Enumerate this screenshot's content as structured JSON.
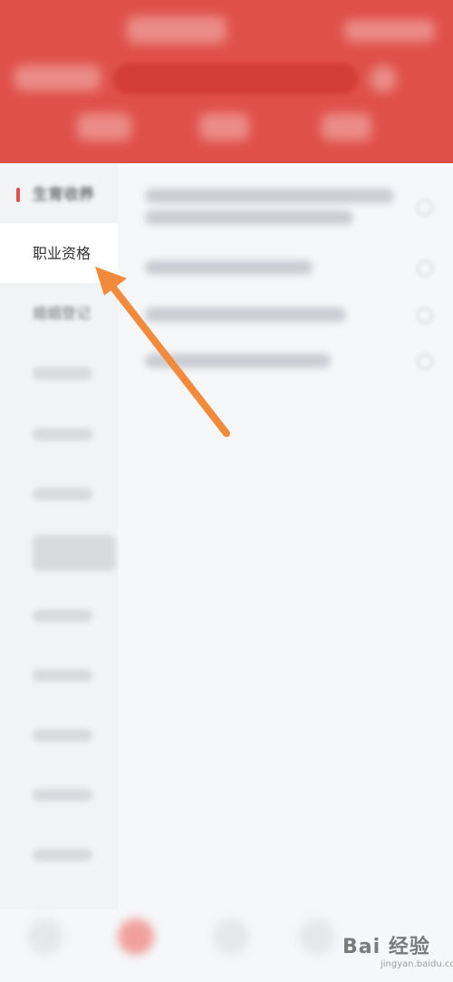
{
  "sidebar": {
    "items": [
      {
        "label": "生育收养"
      },
      {
        "label": "职业资格"
      },
      {
        "label": "婚姻登记"
      }
    ]
  },
  "watermark": {
    "logo": "Bai 经验",
    "sub": "jingyan.baidu.com"
  },
  "colors": {
    "header_red": "#e0504a",
    "arrow_orange": "#f28a3c",
    "active_bg": "#ffffff"
  }
}
